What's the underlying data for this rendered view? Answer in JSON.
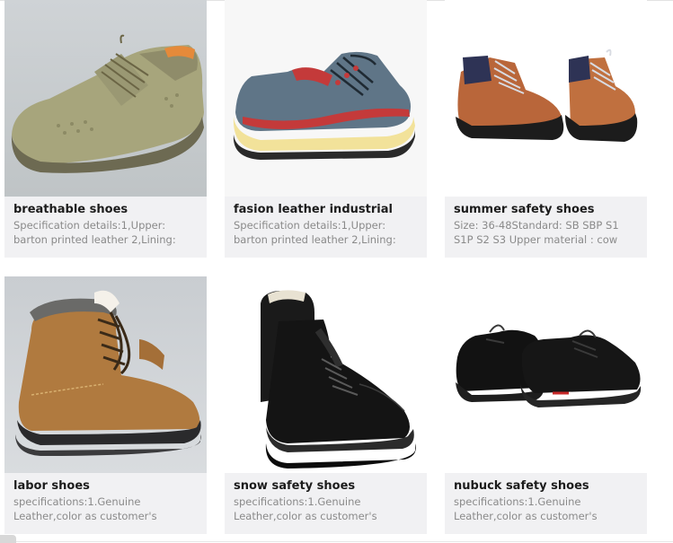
{
  "products": [
    {
      "name": "breathable shoes",
      "description": "Specification details:1,Upper: barton printed leather 2,Lining:",
      "photo_icon": "khaki-mesh-work-shoe"
    },
    {
      "name": "fasion leather industrial",
      "description": "Specification details:1,Upper: barton printed leather 2,Lining:",
      "photo_icon": "blue-grey-suede-safety-shoe"
    },
    {
      "name": "summer safety shoes",
      "description": "Size: 36-48Standard: SB SBP S1 S1P S2 S3 Upper material : cow",
      "photo_icon": "pair-of-hiking-safety-boots"
    },
    {
      "name": "labor shoes",
      "description": "specifications:1.Genuine Leather,color as customer's",
      "photo_icon": "tan-suede-fur-lined-boot"
    },
    {
      "name": "snow safety shoes",
      "description": "specifications:1.Genuine Leather,color as customer's",
      "photo_icon": "black-leather-high-boots"
    },
    {
      "name": "nubuck safety shoes",
      "description": "specifications:1.Genuine Leather,color as customer's",
      "photo_icon": "black-nubuck-low-shoes"
    }
  ],
  "colors": {
    "card_background": "#f1f1f3",
    "title_text": "#1c1c1c",
    "description_text": "#8a8a8a"
  }
}
